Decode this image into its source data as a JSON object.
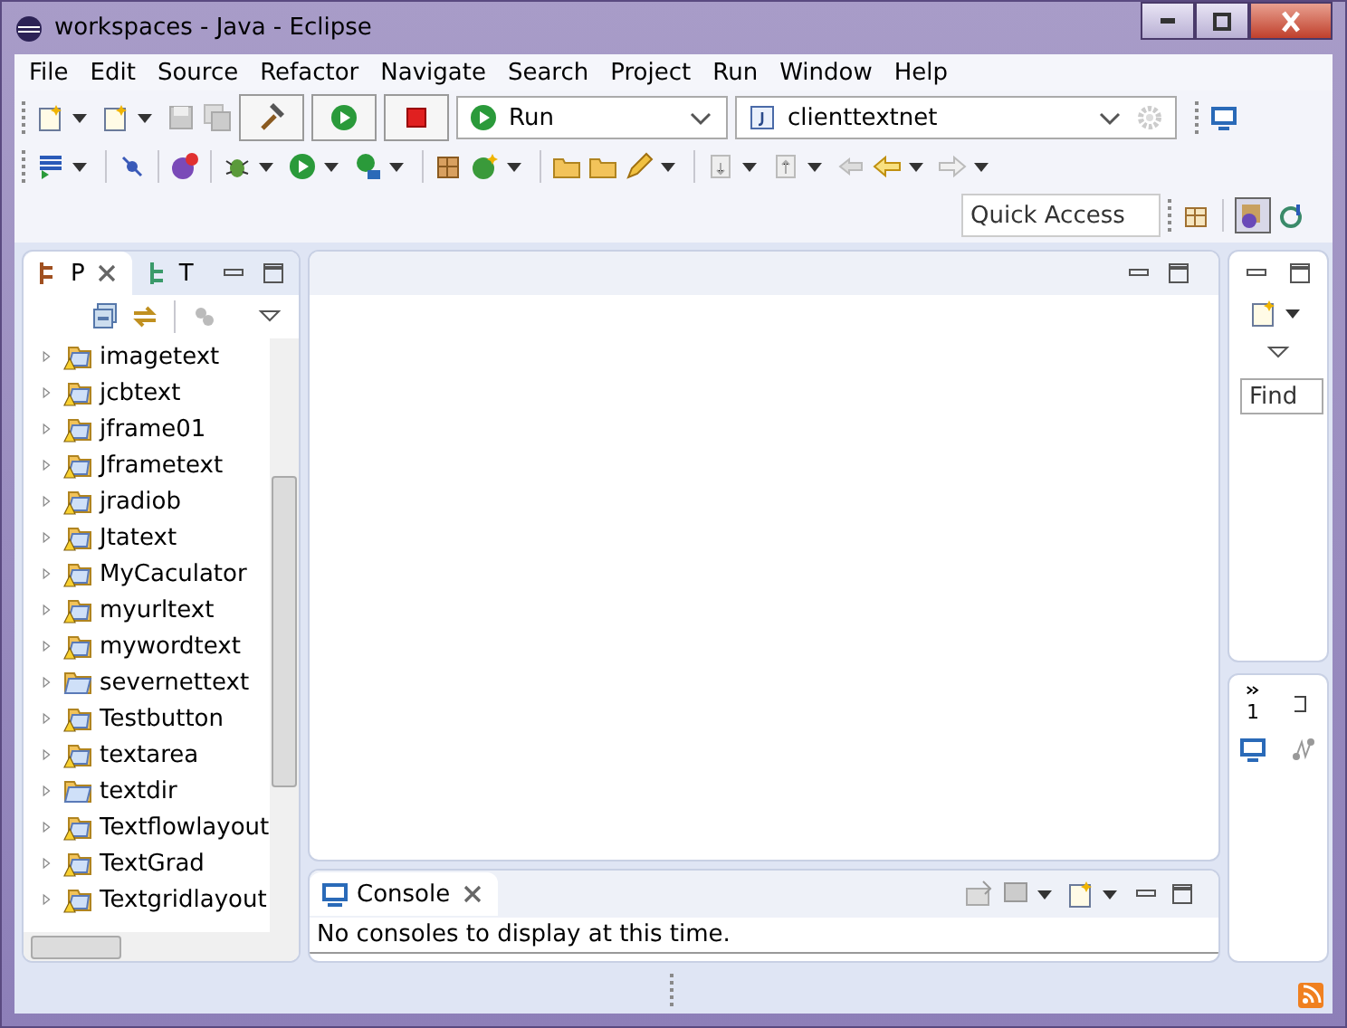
{
  "window": {
    "title": "workspaces - Java - Eclipse"
  },
  "menu": [
    "File",
    "Edit",
    "Source",
    "Refactor",
    "Navigate",
    "Search",
    "Project",
    "Run",
    "Window",
    "Help"
  ],
  "run_combo": {
    "value": "Run"
  },
  "project_combo": {
    "value": "clienttextnet"
  },
  "quick_access": {
    "placeholder": "Quick Access"
  },
  "left_panel": {
    "tabs": [
      {
        "label": "P",
        "selected": true
      },
      {
        "label": "T",
        "selected": false
      }
    ],
    "items": [
      {
        "label": "imagetext",
        "warning": true
      },
      {
        "label": "jcbtext",
        "warning": true
      },
      {
        "label": "jframe01",
        "warning": true
      },
      {
        "label": "Jframetext",
        "warning": true
      },
      {
        "label": "jradiob",
        "warning": true
      },
      {
        "label": "Jtatext",
        "warning": true
      },
      {
        "label": "MyCaculator",
        "warning": true
      },
      {
        "label": "myurltext",
        "warning": true
      },
      {
        "label": "mywordtext",
        "warning": true
      },
      {
        "label": "severnettext",
        "warning": false
      },
      {
        "label": "Testbutton",
        "warning": true
      },
      {
        "label": "textarea",
        "warning": true
      },
      {
        "label": "textdir",
        "warning": false
      },
      {
        "label": "Textflowlayout",
        "warning": true
      },
      {
        "label": "TextGrad",
        "warning": true
      },
      {
        "label": "Textgridlayout",
        "warning": true
      }
    ]
  },
  "right_panel": {
    "find": {
      "placeholder": "Find"
    },
    "overflow_count": "1"
  },
  "console": {
    "tabs": [
      {
        "label": "Console",
        "selected": true
      }
    ],
    "message": "No consoles to display at this time."
  }
}
